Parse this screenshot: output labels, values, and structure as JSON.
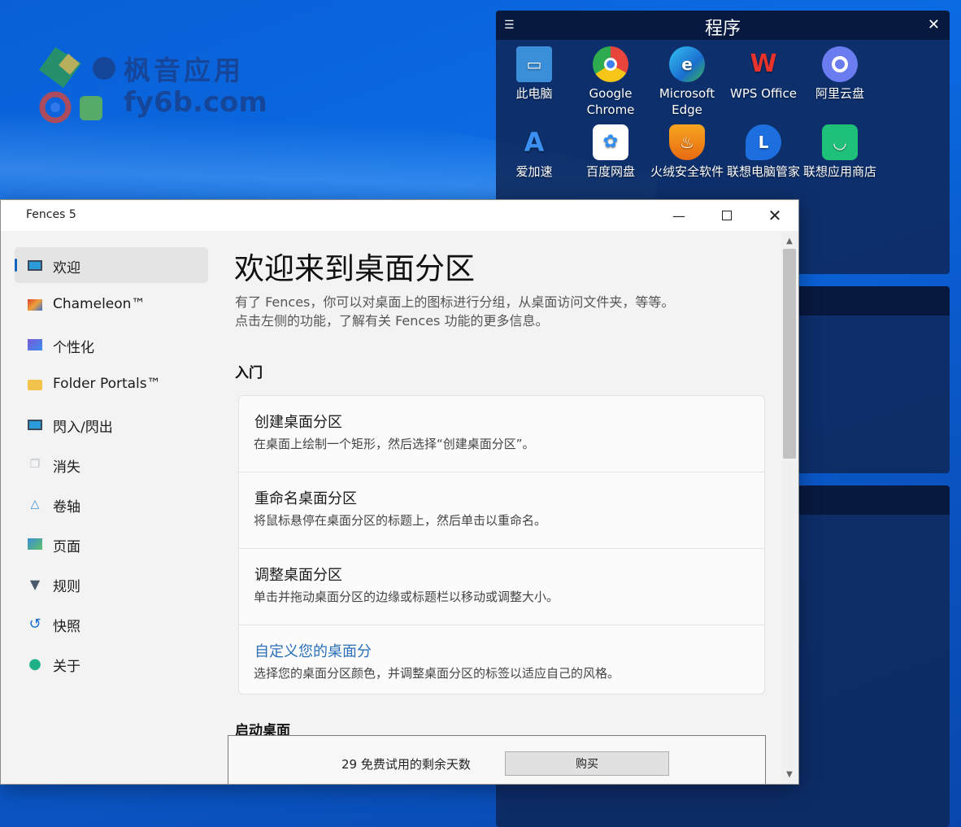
{
  "watermark": {
    "name": "枫音应用",
    "domain": "fy6b.com"
  },
  "fence_panel": {
    "title": "程序",
    "icons": [
      {
        "label": "此电脑",
        "icon": "computer-icon",
        "color": "#3b8fd9"
      },
      {
        "label": "Google Chrome",
        "icon": "chrome-icon",
        "color": "#e8453c"
      },
      {
        "label": "Microsoft Edge",
        "icon": "edge-icon",
        "color": "#1f9bd1"
      },
      {
        "label": "WPS Office",
        "icon": "wps-icon",
        "color": "#e8322c"
      },
      {
        "label": "阿里云盘",
        "icon": "aliyun-drive-icon",
        "color": "#6a7cf0"
      },
      {
        "label": "爱加速",
        "icon": "aijiasu-icon",
        "color": "#3a6fe0"
      },
      {
        "label": "百度网盘",
        "icon": "baidu-netdisk-icon",
        "color": "#2f8ff5"
      },
      {
        "label": "火绒安全软件",
        "icon": "huorong-icon",
        "color": "#f08a1c"
      },
      {
        "label": "联想电脑管家",
        "icon": "lenovo-pc-manager-icon",
        "color": "#1d6fe0"
      },
      {
        "label": "联想应用商店",
        "icon": "lenovo-app-store-icon",
        "color": "#1fc07a"
      }
    ]
  },
  "window": {
    "title": "Fences 5",
    "sidebar": [
      {
        "label": "欢迎",
        "icon": "monitor-icon",
        "active": true
      },
      {
        "label": "Chameleon™",
        "icon": "chameleon-icon"
      },
      {
        "label": "个性化",
        "icon": "personalize-icon"
      },
      {
        "label": "Folder Portals™",
        "icon": "folder-icon"
      },
      {
        "label": "閃入/閃出",
        "icon": "monitor-flash-icon"
      },
      {
        "label": "消失",
        "icon": "fade-icon"
      },
      {
        "label": "卷轴",
        "icon": "roll-icon"
      },
      {
        "label": "页面",
        "icon": "pages-icon"
      },
      {
        "label": "规则",
        "icon": "filter-icon"
      },
      {
        "label": "快照",
        "icon": "undo-icon"
      },
      {
        "label": "关于",
        "icon": "user-icon"
      }
    ],
    "heading": "欢迎来到桌面分区",
    "intro_line1": "有了 Fences，你可以对桌面上的图标进行分组，从桌面访问文件夹，等等。",
    "intro_line2": "点击左侧的功能，了解有关 Fences 功能的更多信息。",
    "section_getting_started": "入门",
    "cards": [
      {
        "title": "创建桌面分区",
        "desc": "在桌面上绘制一个矩形，然后选择“创建桌面分区”。"
      },
      {
        "title": "重命名桌面分区",
        "desc": "将鼠标悬停在桌面分区的标题上，然后单击以重命名。"
      },
      {
        "title": "调整桌面分区",
        "desc": "单击并拖动桌面分区的边缘或标题栏以移动或调整大小。"
      },
      {
        "title": "自定义您的桌面分",
        "desc": "选择您的桌面分区颜色，并调整桌面分区的标签以适应自己的风格。"
      }
    ],
    "section_launch": "启动桌面",
    "trial_text": "29 免费试用的剩余天数",
    "buy_label": "购买"
  }
}
